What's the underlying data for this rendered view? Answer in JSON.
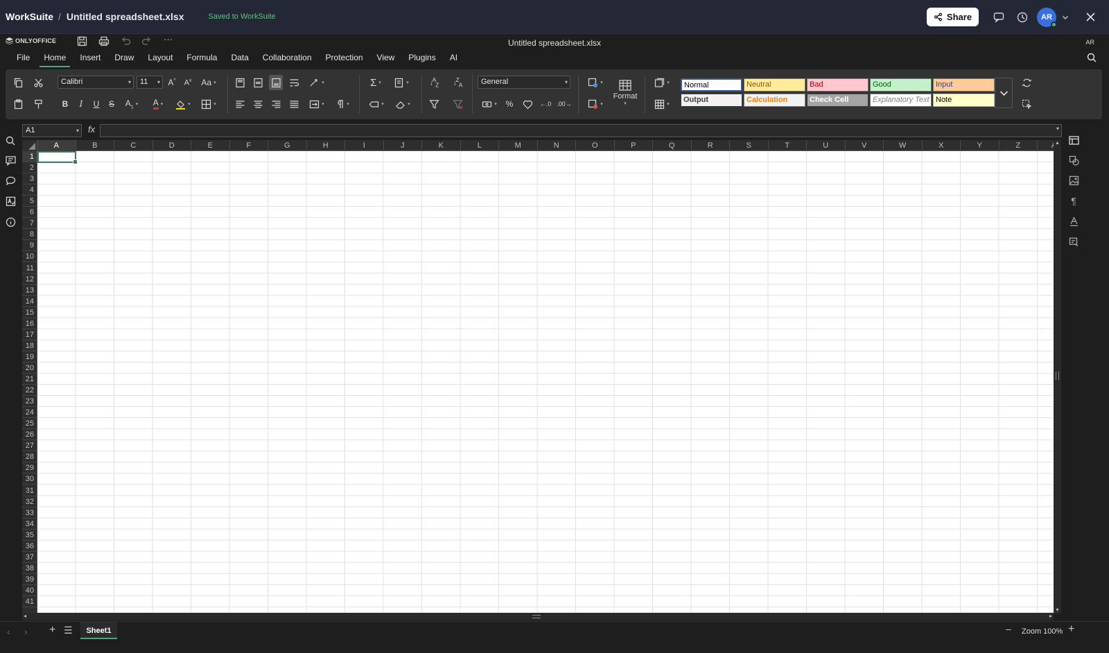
{
  "appbar": {
    "brand": "WorkSuite",
    "separator": "/",
    "doc_name": "Untitled spreadsheet.xlsx",
    "saved_status": "Saved to WorkSuite",
    "share_label": "Share",
    "avatar_initials": "AR"
  },
  "editor": {
    "logo_text": "ONLYOFFICE",
    "title": "Untitled spreadsheet.xlsx",
    "user_initials": "AR"
  },
  "menu": {
    "items": [
      "File",
      "Home",
      "Insert",
      "Draw",
      "Layout",
      "Formula",
      "Data",
      "Collaboration",
      "Protection",
      "View",
      "Plugins",
      "AI"
    ],
    "active": "Home"
  },
  "ribbon": {
    "font_name": "Calibri",
    "font_size": "11",
    "number_format": "General",
    "format_label": "Format",
    "styles": [
      {
        "label": "Normal",
        "bg": "#ffffff",
        "fg": "#000000",
        "border": "#3c5a9a",
        "bold": false,
        "italic": false
      },
      {
        "label": "Neutral",
        "bg": "#ffeb9c",
        "fg": "#9c5700",
        "border": "#777777",
        "bold": false,
        "italic": false
      },
      {
        "label": "Bad",
        "bg": "#ffc7ce",
        "fg": "#9c0006",
        "border": "#777777",
        "bold": false,
        "italic": false
      },
      {
        "label": "Good",
        "bg": "#c6efce",
        "fg": "#006100",
        "border": "#777777",
        "bold": false,
        "italic": false
      },
      {
        "label": "Input",
        "bg": "#ffcc99",
        "fg": "#3f3f76",
        "border": "#777777",
        "bold": false,
        "italic": false
      },
      {
        "label": "Output",
        "bg": "#f2f2f2",
        "fg": "#3f3f3f",
        "border": "#3f3f3f",
        "bold": true,
        "italic": false
      },
      {
        "label": "Calculation",
        "bg": "#f2f2f2",
        "fg": "#fa7d00",
        "border": "#7f7f7f",
        "bold": true,
        "italic": false
      },
      {
        "label": "Check Cell",
        "bg": "#a5a5a5",
        "fg": "#ffffff",
        "border": "#3f3f3f",
        "bold": true,
        "italic": false
      },
      {
        "label": "Explanatory Text",
        "bg": "#ffffff",
        "fg": "#7f7f7f",
        "border": "#777777",
        "bold": false,
        "italic": true
      },
      {
        "label": "Note",
        "bg": "#ffffcc",
        "fg": "#000000",
        "border": "#b2b2b2",
        "bold": false,
        "italic": false
      }
    ]
  },
  "formula_bar": {
    "cell_ref": "A1",
    "fx_label": "fx",
    "formula": ""
  },
  "grid": {
    "columns": [
      "A",
      "B",
      "C",
      "D",
      "E",
      "F",
      "G",
      "H",
      "I",
      "J",
      "K",
      "L",
      "M",
      "N",
      "O",
      "P",
      "Q",
      "R",
      "S",
      "T",
      "U",
      "V",
      "W",
      "X",
      "Y",
      "Z",
      "AA"
    ],
    "rows": [
      "1",
      "2",
      "3",
      "4",
      "5",
      "6",
      "7",
      "8",
      "9",
      "10",
      "11",
      "12",
      "13",
      "14",
      "15",
      "16",
      "17",
      "18",
      "19",
      "20",
      "21",
      "22",
      "23",
      "24",
      "25",
      "26",
      "27",
      "28",
      "29",
      "30",
      "31",
      "32",
      "33",
      "34",
      "35",
      "36",
      "37",
      "38",
      "39",
      "40",
      "41"
    ],
    "selected_cell": "A1"
  },
  "status": {
    "sheet_tab": "Sheet1",
    "zoom_label": "Zoom 100%"
  }
}
